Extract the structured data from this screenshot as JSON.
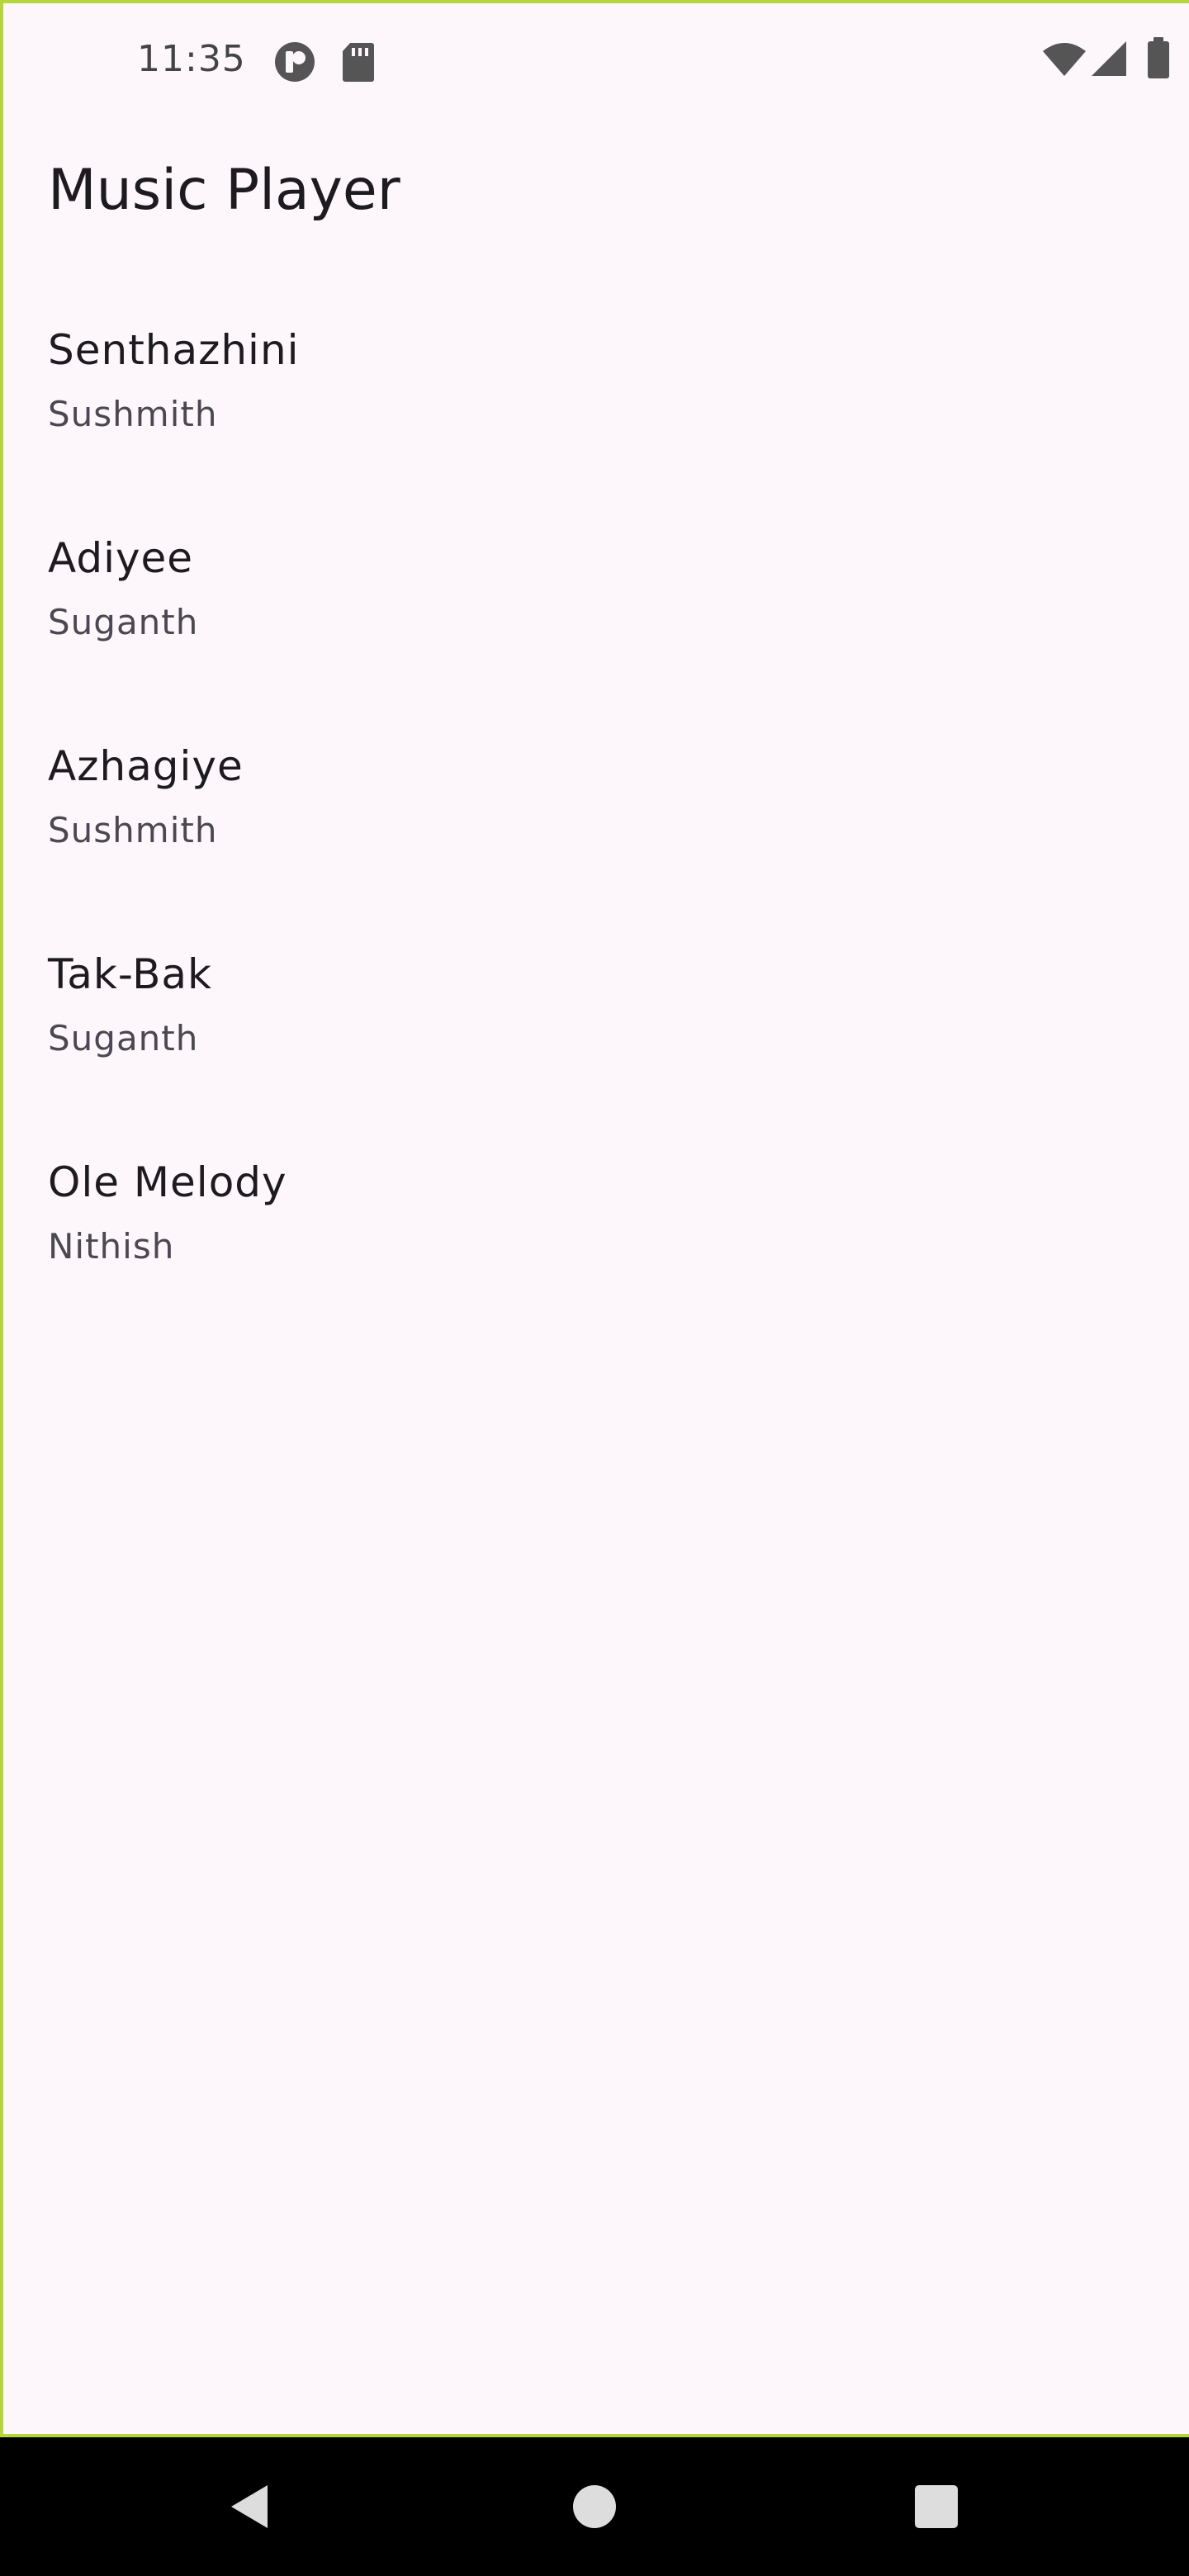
{
  "status_bar": {
    "time": "11:35",
    "left_icons": [
      "app-notification-icon",
      "sd-card-icon"
    ],
    "right_icons": [
      "wifi-icon",
      "cellular-signal-icon",
      "battery-icon"
    ]
  },
  "app_bar": {
    "title": "Music Player"
  },
  "songs": [
    {
      "title": "Senthazhini",
      "artist": "Sushmith"
    },
    {
      "title": "Adiyee",
      "artist": "Suganth"
    },
    {
      "title": "Azhagiye",
      "artist": "Sushmith"
    },
    {
      "title": "Tak-Bak",
      "artist": "Suganth"
    },
    {
      "title": "Ole Melody",
      "artist": "Nithish"
    }
  ],
  "nav_bar": {
    "buttons": [
      "back-icon",
      "home-icon",
      "recents-icon"
    ]
  },
  "colors": {
    "background": "#FDF7FC",
    "frame_border": "#B5D63A",
    "title_text": "#1D1B20",
    "secondary_text": "#4A4850",
    "nav_bar": "#000000"
  }
}
